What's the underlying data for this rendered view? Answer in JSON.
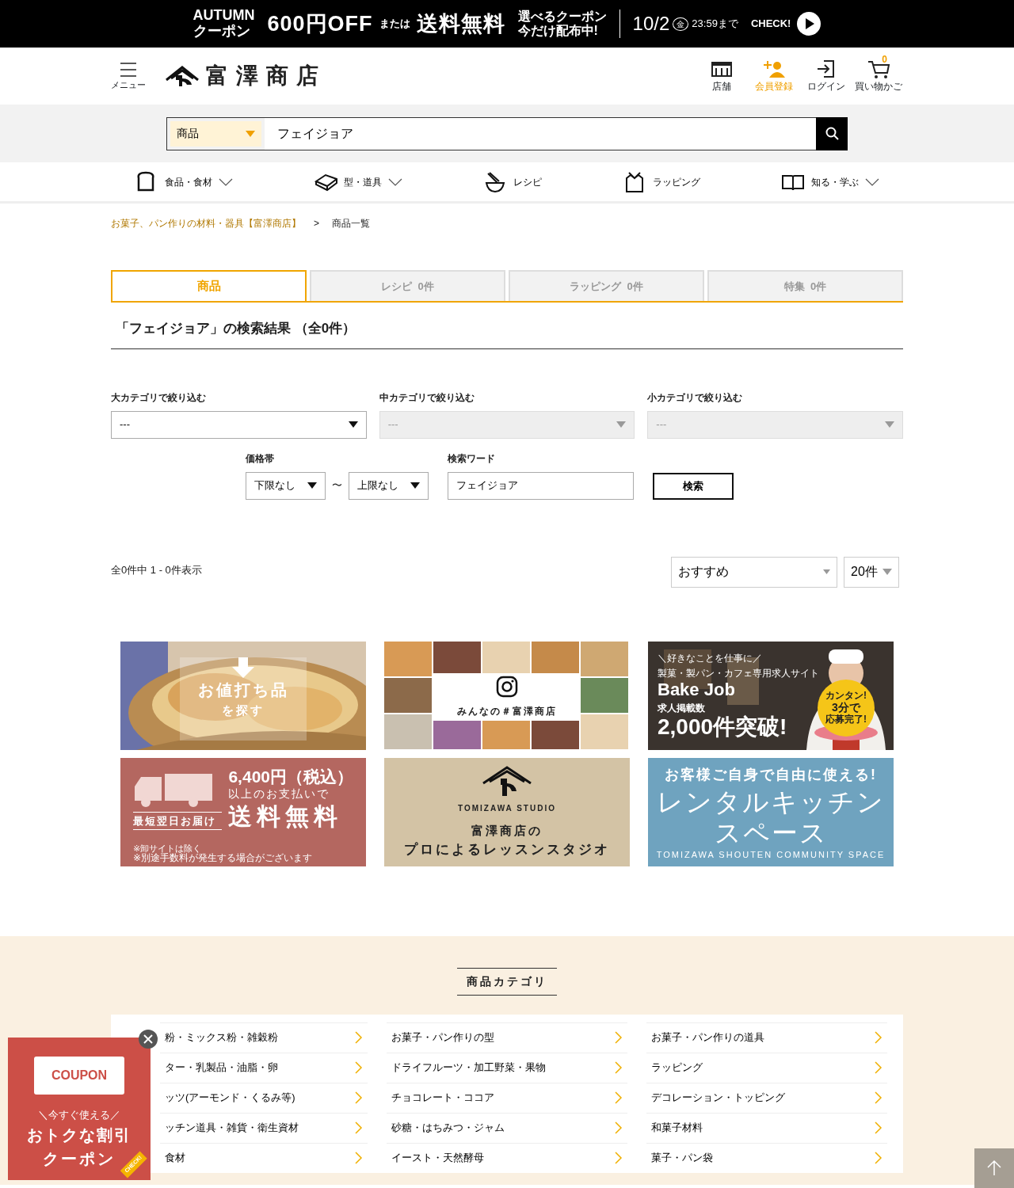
{
  "promo_banner": {
    "season": "AUTUMN",
    "coupon_word": "クーポン",
    "discount": "600円OFF",
    "or": "または",
    "free_shipping": "送料無料",
    "choose": "選べるクーポン",
    "now": "今だけ配布中!",
    "date": "10/2",
    "weekday": "金",
    "deadline": "23:59まで",
    "check": "CHECK!"
  },
  "header": {
    "menu_label": "メニュー",
    "logo": "富澤商店",
    "cart_count": "0",
    "icons": [
      {
        "kind": "store",
        "label": "店舗",
        "highlighted": false
      },
      {
        "kind": "register",
        "label": "会員登録",
        "highlighted": true
      },
      {
        "kind": "login",
        "label": "ログイン",
        "highlighted": false
      },
      {
        "kind": "cart",
        "label": "買い物かご",
        "highlighted": false
      }
    ]
  },
  "search": {
    "category": "商品",
    "value": "フェイジョア"
  },
  "nav": [
    {
      "kind": "bread",
      "label": "食品・食材",
      "dropdown": true
    },
    {
      "kind": "mold",
      "label": "型・道具",
      "dropdown": true
    },
    {
      "kind": "whisk",
      "label": "レシピ",
      "dropdown": false
    },
    {
      "kind": "wrap",
      "label": "ラッピング",
      "dropdown": false
    },
    {
      "kind": "book",
      "label": "知る・学ぶ",
      "dropdown": true
    }
  ],
  "breadcrumb": [
    {
      "label": "お菓子、パン作りの材料・器具【富澤商店】",
      "link": true
    },
    {
      "label": "商品一覧",
      "link": false
    }
  ],
  "breadcrumb_separator": ">",
  "tabs": [
    {
      "label": "商品",
      "selected": true
    },
    {
      "label": "レシピ",
      "count": "0件",
      "selected": false
    },
    {
      "label": "ラッピング",
      "count": "0件",
      "selected": false
    },
    {
      "label": "特集",
      "count": "0件",
      "selected": false
    }
  ],
  "result_title": "「フェイジョア」の検索結果 （全0件）",
  "category_filters": [
    {
      "label": "大カテゴリで絞り込む",
      "value": "---",
      "disabled": false
    },
    {
      "label": "中カテゴリで絞り込む",
      "value": "---",
      "disabled": true
    },
    {
      "label": "小カテゴリで絞り込む",
      "value": "---",
      "disabled": true
    }
  ],
  "price": {
    "label": "価格帯",
    "min": "下限なし",
    "separator": "〜",
    "max": "上限なし"
  },
  "keyword": {
    "label": "検索ワード",
    "value": "フェイジョア"
  },
  "search_button": "検索",
  "result_count": "全0件中 1 - 0件表示",
  "sort": "おすすめ",
  "per_page": "20件",
  "banners": [
    {
      "kind": "bargain",
      "texts": [
        "お値打ち品",
        "を探す"
      ]
    },
    {
      "kind": "instagram",
      "texts": [
        "みんなの＃富澤商店"
      ]
    },
    {
      "kind": "job",
      "texts": [
        "＼好きなことを仕事に／",
        "製菓・製パン・カフェ専用求人サイト",
        "Bake Job",
        "カンタン!",
        "3分で",
        "応募完了!",
        "求人掲載数",
        "2,000件突破!"
      ]
    },
    {
      "kind": "shipping",
      "texts": [
        "最短翌日お届け",
        "6,400円（税込）",
        "以上のお支払いで",
        "送料無料",
        "※卸サイトは除く",
        "※別途手数料が発生する場合がございます"
      ]
    },
    {
      "kind": "studio",
      "texts": [
        "TOMIZAWA STUDIO",
        "富澤商店の",
        "プロによるレッスンスタジオ"
      ]
    },
    {
      "kind": "kitchen",
      "texts": [
        "お客様ご自身で自由に使える!",
        "レンタルキッチン",
        "スペース",
        "TOMIZAWA SHOUTEN COMMUNITY SPACE"
      ]
    }
  ],
  "category_section": {
    "title": "商品カテゴリ",
    "columns": [
      [
        "粉・ミックス粉・雑穀粉",
        "ター・乳製品・油脂・卵",
        "ッツ(アーモンド・くるみ等)",
        "ッチン道具・雑貨・衛生資材",
        "食材"
      ],
      [
        "お菓子・パン作りの型",
        "ドライフルーツ・加工野菜・果物",
        "チョコレート・ココア",
        "砂糖・はちみつ・ジャム",
        "イースト・天然酵母"
      ],
      [
        "お菓子・パン作りの道具",
        "ラッピング",
        "デコレーション・トッピング",
        "和菓子材料",
        "菓子・パン袋"
      ]
    ]
  },
  "coupon": {
    "tag": "COUPON",
    "lead": "＼今すぐ使える／",
    "line1": "おトクな割引",
    "line2": "クーポン",
    "corner": "CHECK!"
  }
}
